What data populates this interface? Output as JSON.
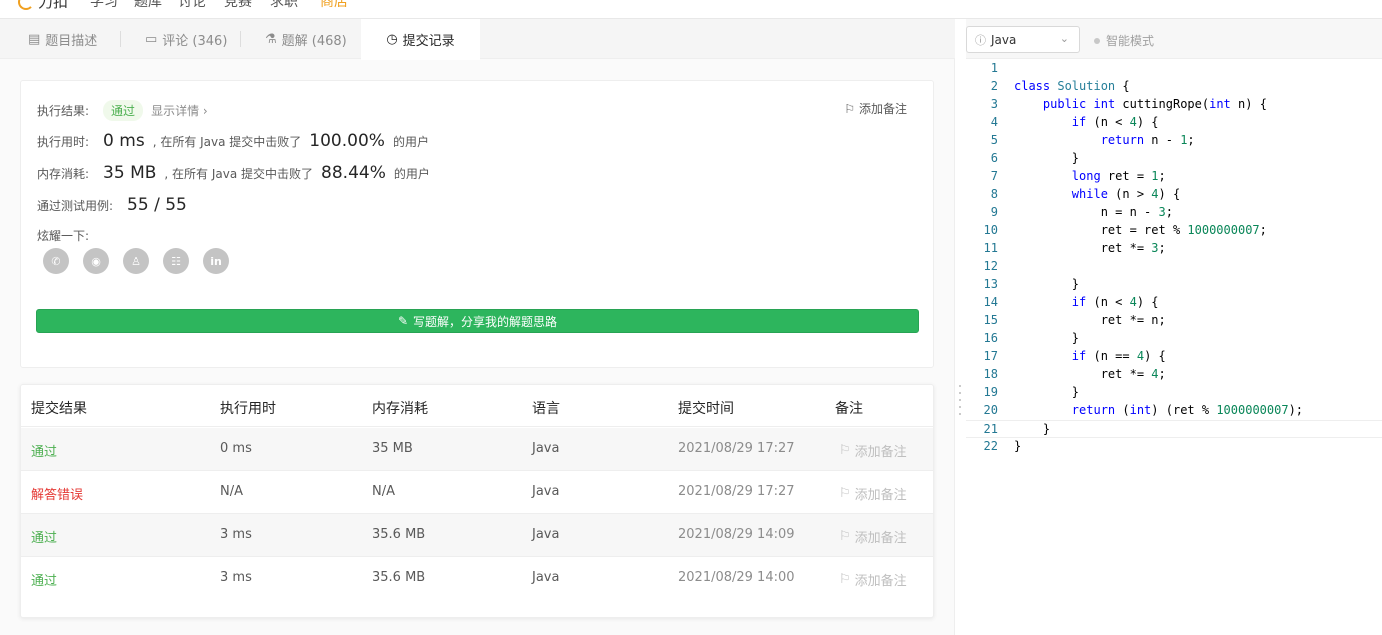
{
  "topnav": {
    "logo": "力扣",
    "items": [
      "学习",
      "题库",
      "讨论",
      "竞赛",
      "求职",
      "商店"
    ]
  },
  "tabs": [
    {
      "label": "题目描述",
      "icon": "description-icon"
    },
    {
      "label": "评论 (346)",
      "icon": "comment-icon"
    },
    {
      "label": "题解 (468)",
      "icon": "flask-icon"
    },
    {
      "label": "提交记录",
      "icon": "clock-icon"
    }
  ],
  "result": {
    "status_label": "执行结果:",
    "status": "通过",
    "detail_link": "显示详情 ›",
    "add_note": "添加备注",
    "runtime_label": "执行用时:",
    "runtime_value": "0 ms",
    "runtime_beat_prefix": ", 在所有 Java 提交中击败了",
    "runtime_beat": "100.00%",
    "runtime_suffix": "的用户",
    "memory_label": "内存消耗:",
    "memory_value": "35 MB",
    "memory_beat_prefix": ", 在所有 Java 提交中击败了",
    "memory_beat": "88.44%",
    "memory_suffix": "的用户",
    "cases_label": "通过测试用例:",
    "cases_value": "55 / 55",
    "share_label": "炫耀一下:",
    "share_icons": [
      "wechat-icon",
      "weibo-icon",
      "qq-icon",
      "douban-icon",
      "linkedin-icon"
    ],
    "write_button": "写题解，分享我的解题思路"
  },
  "submissions": {
    "headers": [
      "提交结果",
      "执行用时",
      "内存消耗",
      "语言",
      "提交时间",
      "备注"
    ],
    "rows": [
      {
        "status": "通过",
        "status_type": "ok",
        "runtime": "0 ms",
        "memory": "35 MB",
        "lang": "Java",
        "time": "2021/08/29 17:27",
        "note": "添加备注"
      },
      {
        "status": "解答错误",
        "status_type": "err",
        "runtime": "N/A",
        "memory": "N/A",
        "lang": "Java",
        "time": "2021/08/29 17:27",
        "note": "添加备注"
      },
      {
        "status": "通过",
        "status_type": "ok",
        "runtime": "3 ms",
        "memory": "35.6 MB",
        "lang": "Java",
        "time": "2021/08/29 14:09",
        "note": "添加备注"
      },
      {
        "status": "通过",
        "status_type": "ok",
        "runtime": "3 ms",
        "memory": "35.6 MB",
        "lang": "Java",
        "time": "2021/08/29 14:00",
        "note": "添加备注"
      }
    ]
  },
  "editor": {
    "language": "Java",
    "smart_mode": "智能模式",
    "current_line": 21,
    "lines": [
      "",
      "class Solution {",
      "    public int cuttingRope(int n) {",
      "        if (n < 4) {",
      "            return n - 1;",
      "        }",
      "        long ret = 1;",
      "        while (n > 4) {",
      "            n = n - 3;",
      "            ret = ret % 1000000007;",
      "            ret *= 3;",
      "",
      "        }",
      "        if (n < 4) {",
      "            ret *= n;",
      "        }",
      "        if (n == 4) {",
      "            ret *= 4;",
      "        }",
      "        return (int) (ret % 1000000007);",
      "    }",
      "}"
    ]
  }
}
